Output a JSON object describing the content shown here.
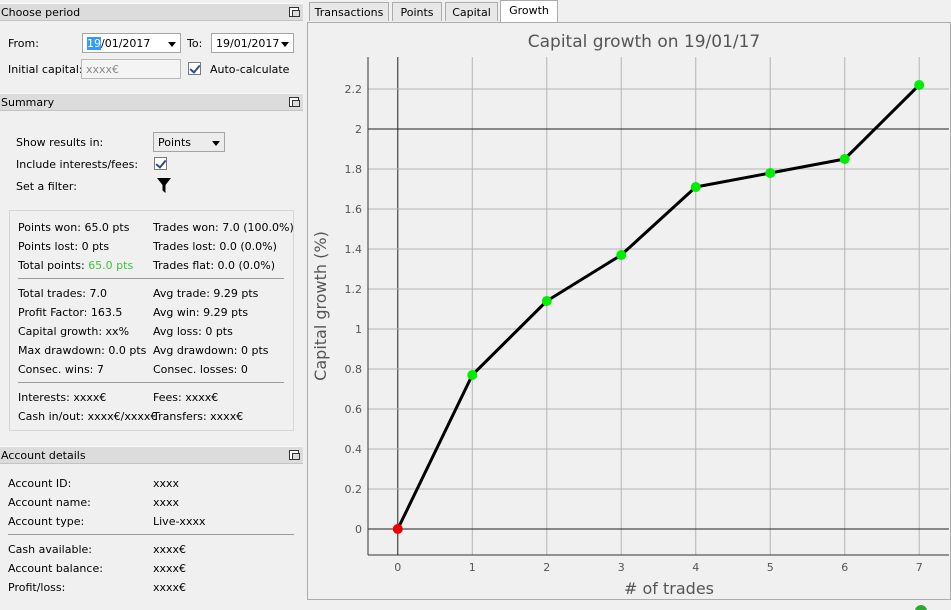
{
  "period": {
    "title": "Choose period",
    "from_label": "From:",
    "from_sel": "19",
    "from_rest": "/01/2017",
    "to_label": "To:",
    "to_value": "19/01/2017",
    "capital_label": "Initial capital:",
    "capital_value": "xxxx€",
    "auto_label": "Auto-calculate",
    "auto_checked": true
  },
  "summary": {
    "title": "Summary",
    "show_label": "Show results in:",
    "show_value": "Points",
    "include_label": "Include interests/fees:",
    "include_checked": true,
    "filter_label": "Set a filter:",
    "stats": {
      "points_won": "Points won: 65.0 pts",
      "points_lost": "Points lost: 0 pts",
      "total_points_label": "Total points: ",
      "total_points_value": "65.0 pts",
      "trades_won": "Trades won: 7.0 (100.0%)",
      "trades_lost": "Trades lost: 0.0 (0.0%)",
      "trades_flat": "Trades flat: 0.0 (0.0%)",
      "total_trades": "Total trades: 7.0",
      "profit_factor": "Profit Factor: 163.5",
      "capital_growth": "Capital growth: xx%",
      "max_drawdown": "Max drawdown: 0.0 pts",
      "consec_wins": "Consec. wins: 7",
      "avg_trade": "Avg trade: 9.29 pts",
      "avg_win": "Avg win: 9.29 pts",
      "avg_loss": "Avg loss: 0 pts",
      "avg_drawdown": "Avg drawdown: 0 pts",
      "consec_losses": "Consec. losses: 0",
      "interests": "Interests: xxxx€",
      "cash_inout": "Cash in/out: xxxx€/xxxx€",
      "fees": "Fees: xxxx€",
      "transfers": "Transfers: xxxx€"
    }
  },
  "account": {
    "title": "Account details",
    "rows1": [
      {
        "label": "Account ID:",
        "value": "xxxx"
      },
      {
        "label": "Account name:",
        "value": "xxxx"
      },
      {
        "label": "Account type:",
        "value": "Live-xxxx"
      }
    ],
    "rows2": [
      {
        "label": "Cash available:",
        "value": "xxxx€"
      },
      {
        "label": "Account balance:",
        "value": "xxxx€"
      },
      {
        "label": "Profit/loss:",
        "value": "xxxx€"
      }
    ]
  },
  "tabs": [
    {
      "label": "Transactions",
      "active": false
    },
    {
      "label": "Points",
      "active": false
    },
    {
      "label": "Capital",
      "active": false
    },
    {
      "label": "Growth",
      "active": true
    }
  ],
  "chart_data": {
    "type": "line",
    "title": "Capital growth on 19/01/17",
    "xlabel": "# of trades",
    "ylabel": "Capital growth (%)",
    "x": [
      0,
      1,
      2,
      3,
      4,
      5,
      6,
      7
    ],
    "y": [
      0,
      0.77,
      1.14,
      1.37,
      1.71,
      1.78,
      1.85,
      2.22
    ],
    "xticks": [
      "0",
      "1",
      "2",
      "3",
      "4",
      "5",
      "6",
      "7"
    ],
    "yticks": [
      "0",
      "0.2",
      "0.4",
      "0.6",
      "0.8",
      "1",
      "1.2",
      "1.4",
      "1.6",
      "1.8",
      "2",
      "2.2"
    ],
    "xlim": [
      -0.4,
      7.4
    ],
    "ylim": [
      -0.13,
      2.36
    ],
    "grid": true,
    "line_color": "#000000",
    "point_color": "#00ee00",
    "first_point_color": "#ee0000"
  }
}
